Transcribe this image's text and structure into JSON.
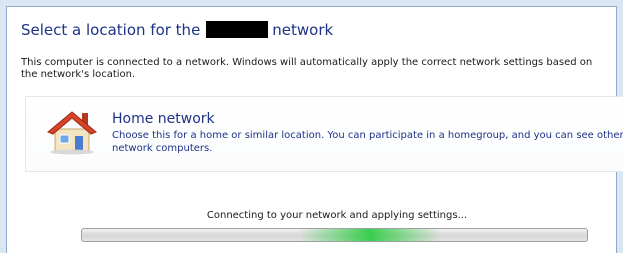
{
  "dialog": {
    "title_before": "Select a location for the",
    "title_after": "network",
    "description": "This computer is connected to a network. Windows will automatically apply the correct network settings based on the network's location."
  },
  "option": {
    "icon": "house-icon",
    "title": "Home network",
    "description": "Choose this for a home or similar location. You can participate in a homegroup, and you can see other network computers."
  },
  "status": {
    "text": "Connecting to your network and applying settings...",
    "progress_marquee_position": 0.57
  },
  "colors": {
    "title": "#1e3287",
    "progress_glow": "#32cd46"
  }
}
